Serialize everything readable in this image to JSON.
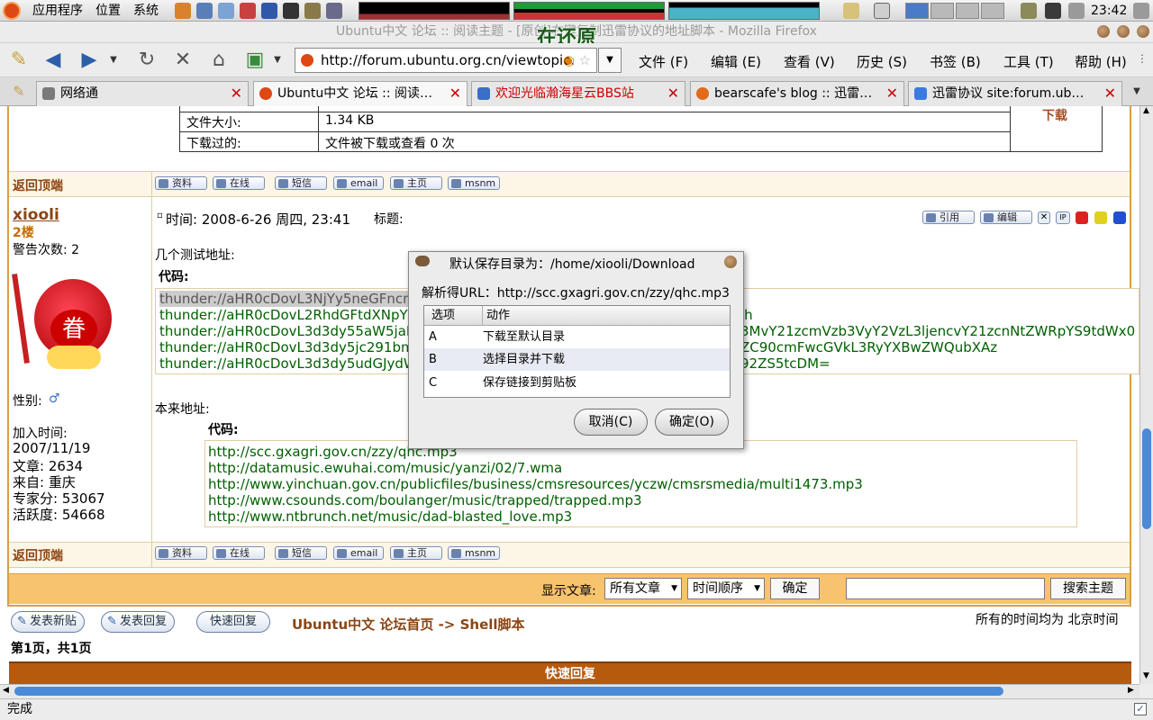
{
  "panel": {
    "apps": "应用程序",
    "places": "位置",
    "system": "系统",
    "clock": "23:42"
  },
  "window": {
    "title": "Ubuntu中文 论坛 :: 阅读主题 - [原创]右键复制迅雷协议的地址脚本 - Mozilla Firefox",
    "overlay_text": "在还原"
  },
  "nav": {
    "url": "http://forum.ubuntu.org.cn/viewtopic.",
    "menu": [
      "文件 (F)",
      "编辑 (E)",
      "查看 (V)",
      "历史 (S)",
      "书签 (B)",
      "工具 (T)",
      "帮助 (H)"
    ]
  },
  "tabs": [
    {
      "label": "网络通",
      "fav": "#7a7a7a"
    },
    {
      "label": "Ubuntu中文 论坛 :: 阅读…",
      "fav": "#dd4814",
      "active": true
    },
    {
      "label": "欢迎光临瀚海星云BBS站",
      "fav": "#3a6ec9"
    },
    {
      "label": "bearscafe's blog :: 迅雷…",
      "fav": "#e06b1a"
    },
    {
      "label": "迅雷协议 site:forum.ub…",
      "fav": "#3b7be0"
    }
  ],
  "prev_post": {
    "file_size_label": "文件大小:",
    "file_size": "1.34 KB",
    "downloaded_label": "下载过的:",
    "downloaded": "文件被下载或查看 0 次",
    "download_link": "下载",
    "back_to_top": "返回顶端"
  },
  "profile_buttons": [
    "资料",
    "在线",
    "短信",
    "email",
    "主页",
    "msnm"
  ],
  "post": {
    "author": "xiooli",
    "floor": "2楼",
    "warnings": "警告次数: 2",
    "avatar_char": "眷",
    "gender_label": "性别:",
    "gender": "♂",
    "join_label": "加入时间:",
    "join_date": "2007/11/19",
    "posts": "文章: 2634",
    "from": "来自: 重庆",
    "expert": "专家分: 53067",
    "activity": "活跃度: 54668",
    "time": "时间: 2008-6-26 周四, 23:41",
    "subject_label": "标题:",
    "quote": "引用",
    "edit": "编辑",
    "intro": "几个测试地址:",
    "code_label": "代码:",
    "thunder": [
      "thunder://aHR0cDovL3NjYy5neGFncmkuZ",
      "thunder://aHR0cDovL2RhdGFtdXNpYy5ld",
      "thunder://aHR0cDovL3d3dy55aW5jaHVhb",
      "thunder://aHR0cDovL3d3dy5jc291bmRzL",
      "thunder://aHR0cDovL3d3dy5udGJydW5jaC"
    ],
    "thunder_tail": [
      "lh",
      "3MvY21zcmVzb3VyY2VzL3ljencvY21zcnNtZWRpYS9tdWx0",
      "ZC90cmFwcGVkL3RyYXBwZWQubXAz",
      "92ZS5tcDM="
    ],
    "orig_label": "本来地址:",
    "orig_code_label": "代码:",
    "urls": [
      "http://scc.gxagri.gov.cn/zzy/qhc.mp3",
      "http://datamusic.ewuhai.com/music/yanzi/02/7.wma",
      "http://www.yinchuan.gov.cn/publicfiles/business/cmsresources/yczw/cmsrsmedia/multi1473.mp3",
      "http://www.csounds.com/boulanger/music/trapped/trapped.mp3",
      "http://www.ntbrunch.net/music/dad-blasted_love.mp3"
    ]
  },
  "filter": {
    "label": "显示文章:",
    "all": "所有文章",
    "order": "时间顺序",
    "ok": "确定",
    "search": "",
    "search_btn": "搜索主题"
  },
  "footer": {
    "new_topic": "发表新贴",
    "reply": "发表回复",
    "quick_reply_btn": "快速回复",
    "breadcrumb": "Ubuntu中文 论坛首页 -> Shell脚本",
    "timezone": "所有的时间均为 北京时间",
    "pages": "第1页，共1页",
    "quick_reply": "快速回复"
  },
  "dialog": {
    "title": "默认保存目录为：/home/xiooli/Download",
    "url_line": "解析得URL：http://scc.gxagri.gov.cn/zzy/qhc.mp3",
    "col_option": "选项",
    "col_action": "动作",
    "rows": [
      {
        "opt": "A",
        "act": "下载至默认目录"
      },
      {
        "opt": "B",
        "act": "选择目录并下载"
      },
      {
        "opt": "C",
        "act": "保存链接到剪贴板"
      }
    ],
    "cancel": "取消(C)",
    "ok": "确定(O)"
  },
  "status": "完成"
}
